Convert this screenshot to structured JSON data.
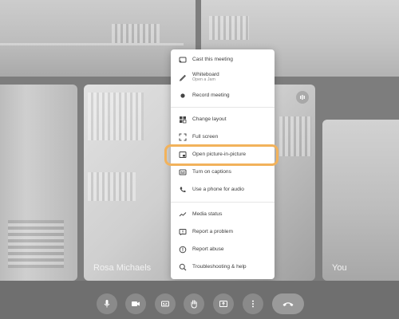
{
  "tiles": {
    "center_name": "Rosa Michaels",
    "right_name": "You"
  },
  "menu": {
    "items": [
      {
        "label": "Cast this meeting",
        "icon": "cast-icon"
      },
      {
        "label": "Whiteboard",
        "sublabel": "Open a Jam",
        "icon": "pen-icon"
      },
      {
        "label": "Record meeting",
        "icon": "record-icon"
      },
      {
        "label": "Change layout",
        "icon": "layout-icon"
      },
      {
        "label": "Full screen",
        "icon": "fullscreen-icon"
      },
      {
        "label": "Open picture-in-picture",
        "icon": "picture-in-picture-icon"
      },
      {
        "label": "Turn on captions",
        "icon": "captions-icon"
      },
      {
        "label": "Use a phone for audio",
        "icon": "phone-icon"
      },
      {
        "label": "Media status",
        "icon": "media-status-icon"
      },
      {
        "label": "Report a problem",
        "icon": "report-problem-icon"
      },
      {
        "label": "Report abuse",
        "icon": "report-abuse-icon"
      },
      {
        "label": "Troubleshooting & help",
        "icon": "troubleshooting-icon"
      }
    ]
  },
  "controls": [
    {
      "icon": "microphone-icon"
    },
    {
      "icon": "camera-icon"
    },
    {
      "icon": "captions-icon"
    },
    {
      "icon": "raise-hand-icon"
    },
    {
      "icon": "present-icon"
    },
    {
      "icon": "more-options-icon"
    },
    {
      "icon": "end-call-icon"
    }
  ],
  "colors": {
    "highlight": "#f2b25b",
    "menu_background": "#ffffff"
  }
}
